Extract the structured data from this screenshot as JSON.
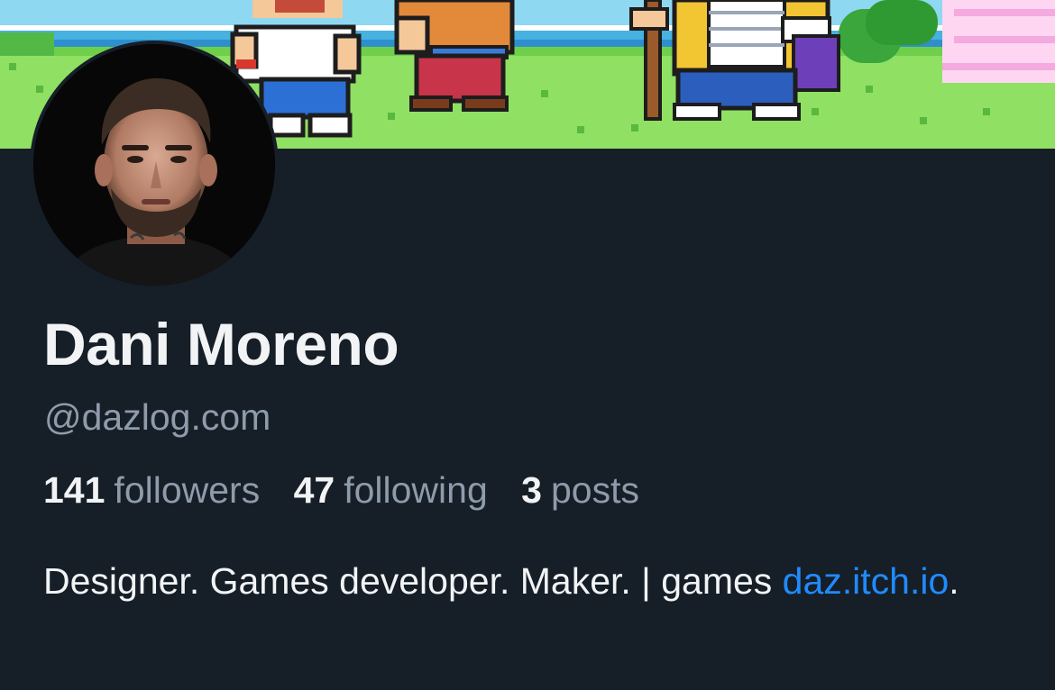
{
  "profile": {
    "display_name": "Dani Moreno",
    "handle": "@dazlog.com",
    "stats": {
      "followers_count": "141",
      "followers_label": "followers",
      "following_count": "47",
      "following_label": "following",
      "posts_count": "3",
      "posts_label": "posts"
    },
    "bio": {
      "text": "Designer. Games developer. Maker. | games ",
      "link_text": "daz.itch.io",
      "trailing": "."
    }
  },
  "colors": {
    "background": "#161e27",
    "primary_text": "#f1f3f5",
    "secondary_text": "#8e9bab",
    "link": "#208bfe",
    "banner_grass": "#8fe063",
    "banner_sky": "#8fd8f2"
  },
  "icons": {
    "banner": "pixel-art-banner",
    "avatar": "profile-photo"
  }
}
